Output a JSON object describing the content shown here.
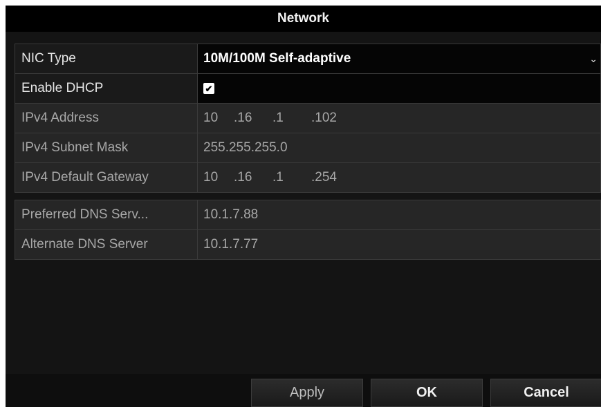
{
  "dialog": {
    "title": "Network",
    "nic_type": {
      "label": "NIC Type",
      "value": "10M/100M Self-adaptive",
      "icon": "chevron-down-icon"
    },
    "dhcp": {
      "label": "Enable DHCP",
      "checked": true,
      "check_glyph": "✔"
    },
    "ipv4_address": {
      "label": "IPv4 Address",
      "octets": [
        "10",
        ".16",
        ".1",
        ".102"
      ]
    },
    "ipv4_subnet_mask": {
      "label": "IPv4 Subnet Mask",
      "octets": [
        "255",
        ".255",
        ".255",
        ".0"
      ]
    },
    "ipv4_default_gateway": {
      "label": "IPv4 Default Gateway",
      "octets": [
        "10",
        ".16",
        ".1",
        ".254"
      ]
    },
    "preferred_dns": {
      "label": "Preferred DNS Serv...",
      "value": "10.1.7.88"
    },
    "alternate_dns": {
      "label": "Alternate DNS Server",
      "value": "10.1.7.77"
    }
  },
  "footer": {
    "apply_label": "Apply",
    "ok_label": "OK",
    "cancel_label": "Cancel"
  },
  "colors": {
    "background": "#141414",
    "titlebar": "#000000",
    "text_active": "#ffffff",
    "text_disabled": "#a8a8a8"
  }
}
